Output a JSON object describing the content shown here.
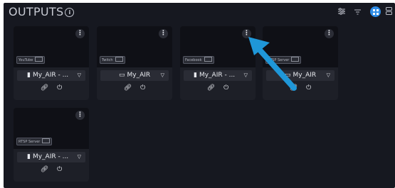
{
  "header": {
    "title": "OUTPUTS",
    "info_icon": "info-icon",
    "icons": [
      "filter-sliders-icon",
      "filter-icon",
      "grid-view-icon",
      "list-view-icon"
    ]
  },
  "cards": [
    {
      "platform": "YouTube",
      "output_name": "My_AIR - ...",
      "type_icon": "file-icon"
    },
    {
      "platform": "Twitch",
      "output_name": "My_AIR",
      "type_icon": "camera-icon"
    },
    {
      "platform": "Facebook",
      "output_name": "My_AIR - ...",
      "type_icon": "file-icon"
    },
    {
      "platform": "RTSP Server",
      "output_name": "My_AIR",
      "type_icon": "camera-icon"
    },
    {
      "platform": "RTSP Server",
      "output_name": "My_AIR - ...",
      "type_icon": "file-icon"
    }
  ],
  "colors": {
    "accent": "#2e8ce6",
    "arrow": "#1f97d8",
    "background": "#161820"
  }
}
